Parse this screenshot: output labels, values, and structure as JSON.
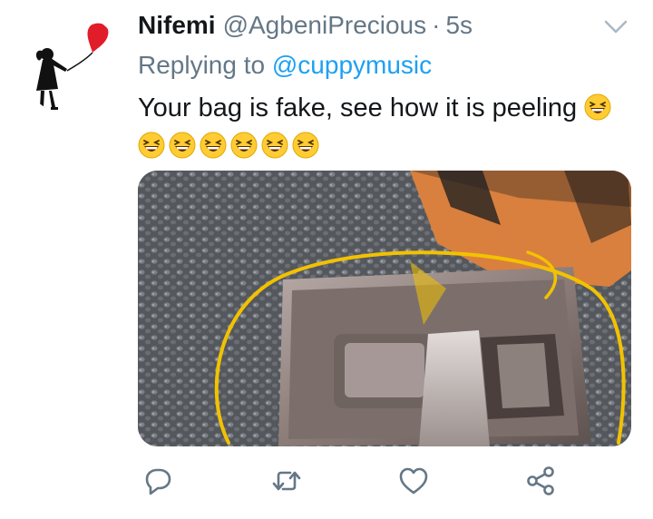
{
  "author": {
    "display_name": "Nifemi",
    "handle": "@AgbeniPrecious",
    "separator": "·",
    "time_ago": "5s"
  },
  "reply": {
    "prefix": "Replying to",
    "mention": "@cuppymusic"
  },
  "tweet": {
    "text": "Your bag is fake, see how it is peeling",
    "trailing_emoji": "grinning-squinting-face",
    "emoji_row_count": 6
  },
  "icons": {
    "reply": "reply-icon",
    "retweet": "retweet-icon",
    "like": "heart-icon",
    "share": "share-icon",
    "menu": "chevron-down-icon"
  },
  "colors": {
    "text": "#14171a",
    "secondary": "#657786",
    "link": "#1da1f2",
    "icon": "#657786",
    "highlight_circle": "#f2c200"
  }
}
